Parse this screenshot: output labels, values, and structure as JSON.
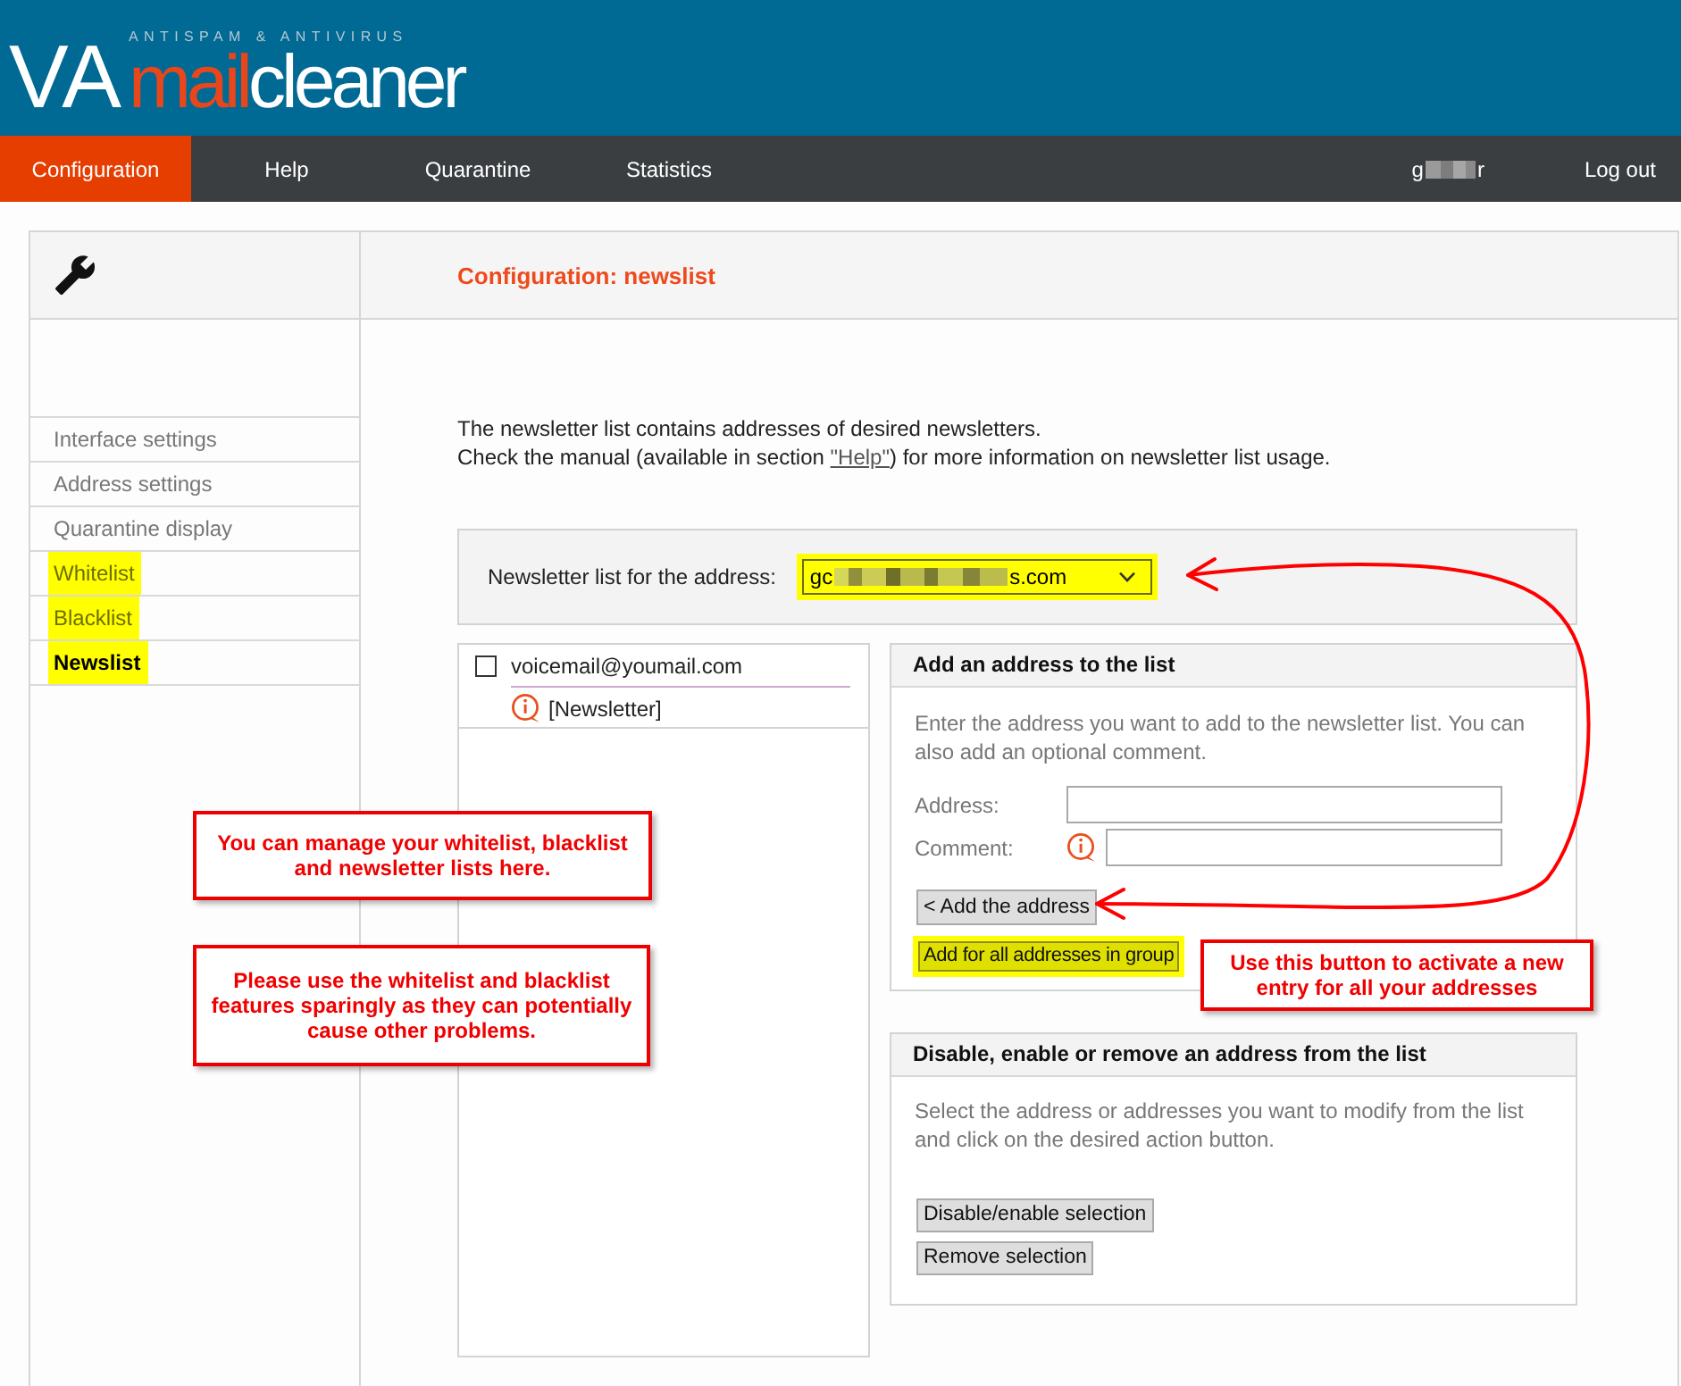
{
  "header": {
    "tagline": "ANTISPAM & ANTIVIRUS",
    "logo_initials": "VA",
    "logo_word_1": "mail",
    "logo_word_2": "cleaner"
  },
  "nav": {
    "tabs": [
      {
        "label": "Configuration",
        "selected": true
      },
      {
        "label": "Help",
        "selected": false
      },
      {
        "label": "Quarantine",
        "selected": false
      },
      {
        "label": "Statistics",
        "selected": false
      }
    ],
    "user": {
      "visible_start": "g",
      "visible_end": "r",
      "redacted": true
    },
    "logout": "Log out"
  },
  "panel_title": "Configuration: newslist",
  "sidebar": {
    "items": [
      {
        "label": "Interface settings",
        "selected": false,
        "highlighted": false
      },
      {
        "label": "Address settings",
        "selected": false,
        "highlighted": false
      },
      {
        "label": "Quarantine display",
        "selected": false,
        "highlighted": false
      },
      {
        "label": "Whitelist",
        "selected": false,
        "highlighted": true
      },
      {
        "label": "Blacklist",
        "selected": false,
        "highlighted": true
      },
      {
        "label": "Newslist",
        "selected": true,
        "highlighted": true
      }
    ]
  },
  "intro": [
    {
      "text": "The newsletter list contains addresses of desired newsletters."
    },
    {
      "text": "Check the manual (available in section ",
      "link": "\"Help\"",
      "after": ") for more information on newsletter list usage."
    }
  ],
  "address_selector": {
    "label": "Newsletter list for the address:",
    "value_start": "gc",
    "value_end": "s.com",
    "redacted": true,
    "highlighted": true
  },
  "entries": [
    {
      "address": "voicemail@youmail.com",
      "checked": false,
      "comment": "[Newsletter]"
    }
  ],
  "add_panel": {
    "title": "Add an address to the list",
    "description": "Enter the address you want to add to the newsletter list. You can also add an optional comment.",
    "fields": [
      {
        "label": "Address:",
        "info_icon": false
      },
      {
        "label": "Comment:",
        "info_icon": true
      }
    ],
    "buttons": [
      {
        "label": "< Add the address",
        "highlighted": false
      },
      {
        "label": "Add for all addresses in group",
        "highlighted": true
      }
    ]
  },
  "remove_panel": {
    "title": "Disable, enable or remove an address from the list",
    "description": "Select the address or addresses you want to modify from the list and click on the desired action button.",
    "buttons": [
      {
        "label": "Disable/enable selection",
        "highlighted": false
      },
      {
        "label": "Remove selection",
        "highlighted": false
      }
    ]
  },
  "annotations": [
    {
      "text": "You can manage your whitelist, blacklist and newsletter lists here."
    },
    {
      "text": "Please use the whitelist and blacklist features sparingly as they can potentially cause other problems."
    },
    {
      "text": "Use this button to activate a new entry for all your addresses"
    }
  ]
}
